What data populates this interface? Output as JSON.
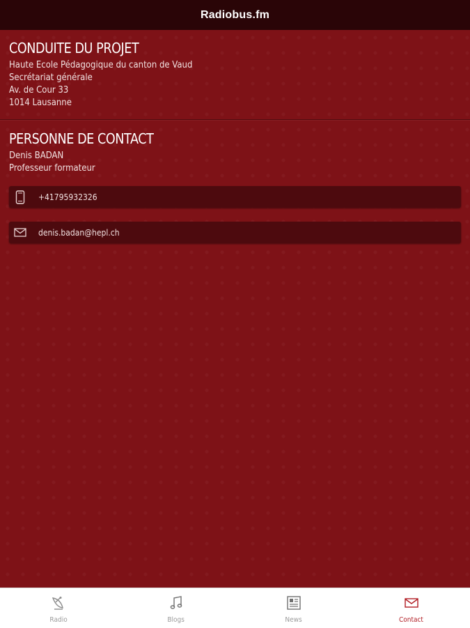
{
  "header": {
    "title": "Radiobus.fm"
  },
  "project": {
    "heading": "CONDUITE DU PROJET",
    "lines": [
      "Haute Ecole Pédagogique du canton de Vaud",
      "Secrétariat générale",
      "Av. de Cour 33",
      "1014 Lausanne"
    ]
  },
  "contact": {
    "heading": "PERSONNE DE CONTACT",
    "lines": [
      "Denis BADAN",
      "Professeur formateur"
    ],
    "phone": {
      "icon": "phone-icon",
      "value": "+41795932326"
    },
    "email": {
      "icon": "mail-icon",
      "value": "denis.badan@hepl.ch"
    }
  },
  "tabs": [
    {
      "label": "Radio",
      "icon": "satellite-dish-icon",
      "active": false
    },
    {
      "label": "Blogs",
      "icon": "music-note-icon",
      "active": false
    },
    {
      "label": "News",
      "icon": "newspaper-icon",
      "active": false
    },
    {
      "label": "Contact",
      "icon": "envelope-icon",
      "active": true
    }
  ],
  "colors": {
    "header_bg": "#2a0507",
    "content_bg": "#7e1217",
    "row_bg": "#4d0a0e",
    "active_tab": "#b01b22",
    "inactive_tab": "#9a9a9a"
  }
}
